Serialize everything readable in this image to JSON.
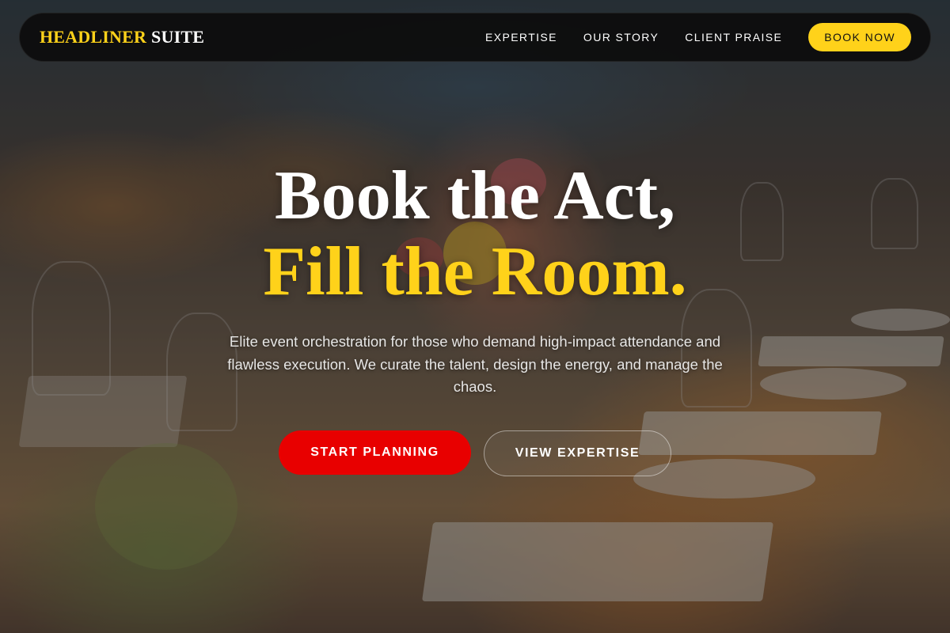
{
  "brand": {
    "name_primary": "HEADLINER",
    "name_secondary": "SUITE"
  },
  "nav": {
    "links": [
      {
        "label": "EXPERTISE"
      },
      {
        "label": "OUR STORY"
      },
      {
        "label": "CLIENT PRAISE"
      }
    ],
    "book_button": "BOOK NOW"
  },
  "hero": {
    "headline_line1": "Book the Act,",
    "headline_line2": "Fill the Room.",
    "subtitle": "Elite event orchestration for those who demand high-impact attendance and flawless execution. We curate the talent, design the energy, and manage the chaos.",
    "primary_cta": "START PLANNING",
    "secondary_cta": "VIEW EXPERTISE"
  },
  "colors": {
    "accent_yellow": "#ffd21a",
    "cta_red": "#e80000",
    "nav_background": "#0c0c0c"
  },
  "background": {
    "image_subject": "banquet-table-photo"
  }
}
